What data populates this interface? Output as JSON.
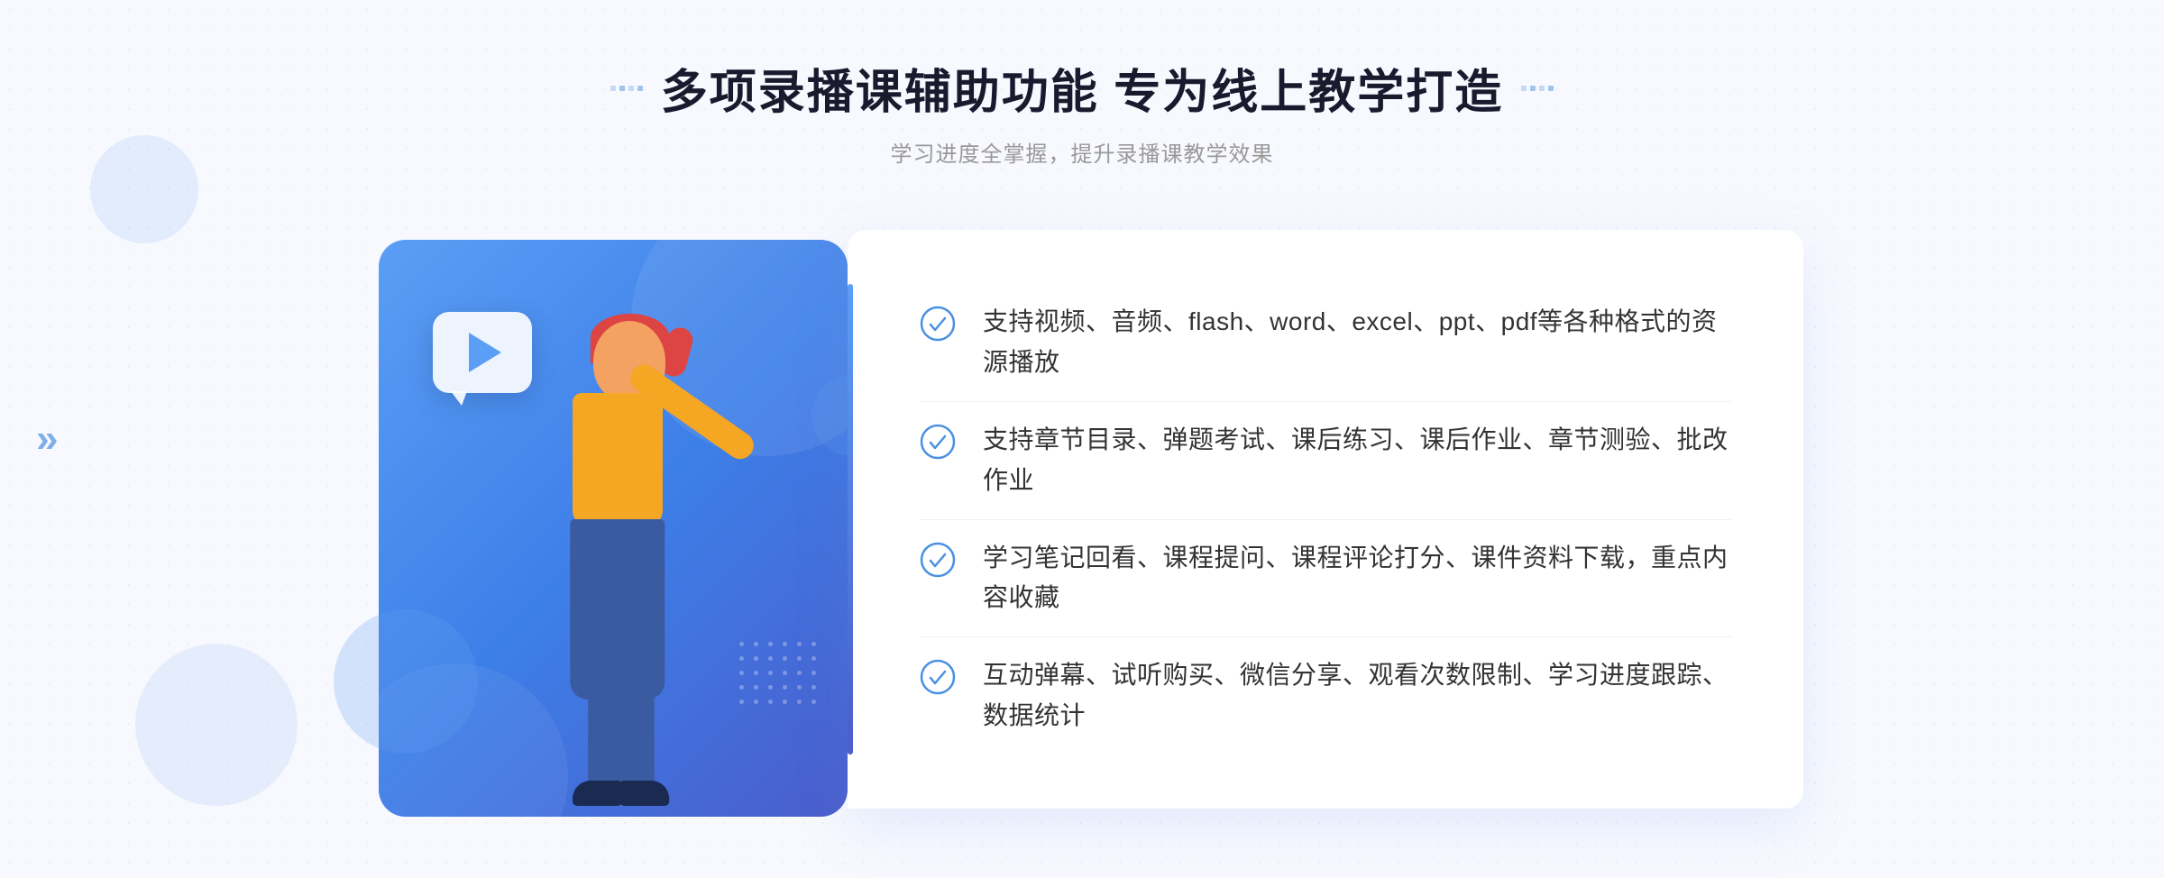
{
  "header": {
    "title": "多项录播课辅助功能 专为线上教学打造",
    "subtitle": "学习进度全掌握，提升录播课教学效果",
    "title_deco_left": "decoration",
    "title_deco_right": "decoration"
  },
  "features": [
    {
      "id": 1,
      "text": "支持视频、音频、flash、word、excel、ppt、pdf等各种格式的资源播放"
    },
    {
      "id": 2,
      "text": "支持章节目录、弹题考试、课后练习、课后作业、章节测验、批改作业"
    },
    {
      "id": 3,
      "text": "学习笔记回看、课程提问、课程评论打分、课件资料下载，重点内容收藏"
    },
    {
      "id": 4,
      "text": "互动弹幕、试听购买、微信分享、观看次数限制、学习进度跟踪、数据统计"
    }
  ],
  "illustration": {
    "play_button_label": "play",
    "check_icon": "✓"
  },
  "colors": {
    "primary_blue": "#4a90e2",
    "gradient_start": "#5b9ef5",
    "gradient_end": "#4a5dcc",
    "text_dark": "#1a1a2e",
    "text_gray": "#999999",
    "text_body": "#333333",
    "bg_light": "#f8f9ff",
    "white": "#ffffff"
  },
  "left_nav": {
    "arrow": "»"
  }
}
